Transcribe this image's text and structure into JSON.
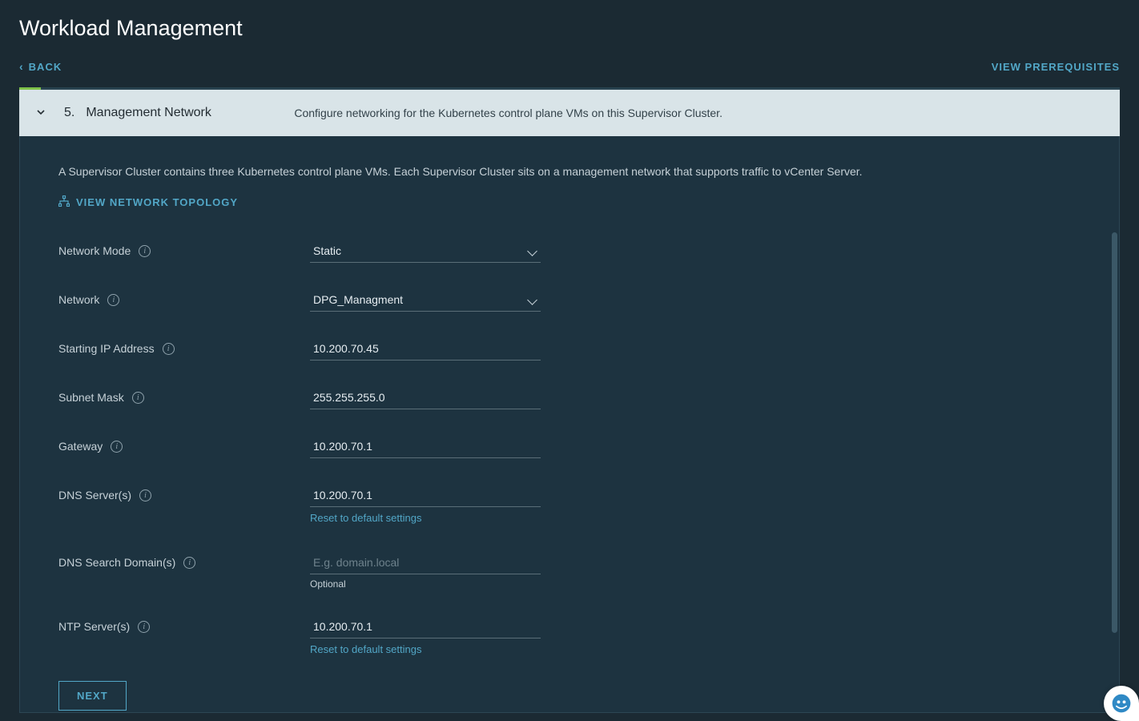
{
  "page": {
    "title": "Workload Management",
    "back": "BACK",
    "view_prerequisites": "VIEW PREREQUISITES"
  },
  "step": {
    "number": "5.",
    "title": "Management Network",
    "description": "Configure networking for the Kubernetes control plane VMs on this Supervisor Cluster."
  },
  "body": {
    "intro": "A Supervisor Cluster contains three Kubernetes control plane VMs. Each Supervisor Cluster sits on a management network that supports traffic to vCenter Server.",
    "view_topology": "VIEW NETWORK TOPOLOGY"
  },
  "form": {
    "network_mode": {
      "label": "Network Mode",
      "value": "Static"
    },
    "network": {
      "label": "Network",
      "value": "DPG_Managment"
    },
    "starting_ip": {
      "label": "Starting IP Address",
      "value": "10.200.70.45"
    },
    "subnet_mask": {
      "label": "Subnet Mask",
      "value": "255.255.255.0"
    },
    "gateway": {
      "label": "Gateway",
      "value": "10.200.70.1"
    },
    "dns_servers": {
      "label": "DNS Server(s)",
      "value": "10.200.70.1",
      "reset": "Reset to default settings"
    },
    "dns_search": {
      "label": "DNS Search Domain(s)",
      "placeholder": "E.g. domain.local",
      "helper": "Optional"
    },
    "ntp_servers": {
      "label": "NTP Server(s)",
      "value": "10.200.70.1",
      "reset": "Reset to default settings"
    }
  },
  "buttons": {
    "next": "NEXT"
  }
}
